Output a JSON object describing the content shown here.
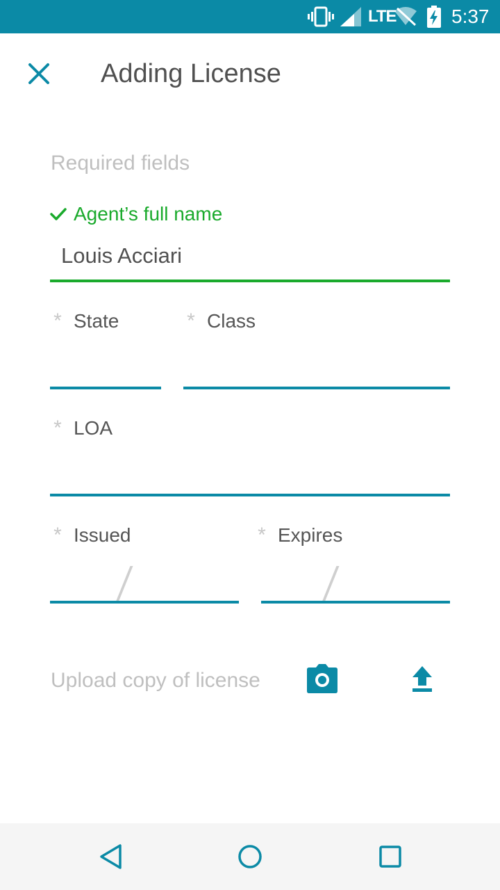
{
  "status_bar": {
    "network": "LTE",
    "time": "5:37",
    "icons": [
      "vibrate-icon",
      "signal-icon",
      "wifi-off-icon",
      "battery-charging-icon"
    ]
  },
  "header": {
    "title": "Adding License",
    "close_icon": "close-icon"
  },
  "form": {
    "section_label": "Required fields",
    "agent_name": {
      "label": "Agent’s full name",
      "value": "Louis Acciari",
      "status": "valid"
    },
    "state": {
      "required_mark": "*",
      "label": "State",
      "value": ""
    },
    "class": {
      "required_mark": "*",
      "label": "Class",
      "value": ""
    },
    "loa": {
      "required_mark": "*",
      "label": "LOA",
      "value": ""
    },
    "issued": {
      "required_mark": "*",
      "label": "Issued",
      "value": ""
    },
    "expires": {
      "required_mark": "*",
      "label": "Expires",
      "value": ""
    }
  },
  "upload": {
    "label": "Upload copy of license",
    "camera_icon": "camera-icon",
    "upload_icon": "upload-icon"
  },
  "nav_bar": {
    "icons": [
      "back-icon",
      "home-icon",
      "recents-icon"
    ]
  },
  "colors": {
    "accent": "#0b8aa6",
    "valid": "#1aaa2c",
    "hint": "#bfbfbf",
    "text": "#505050"
  }
}
